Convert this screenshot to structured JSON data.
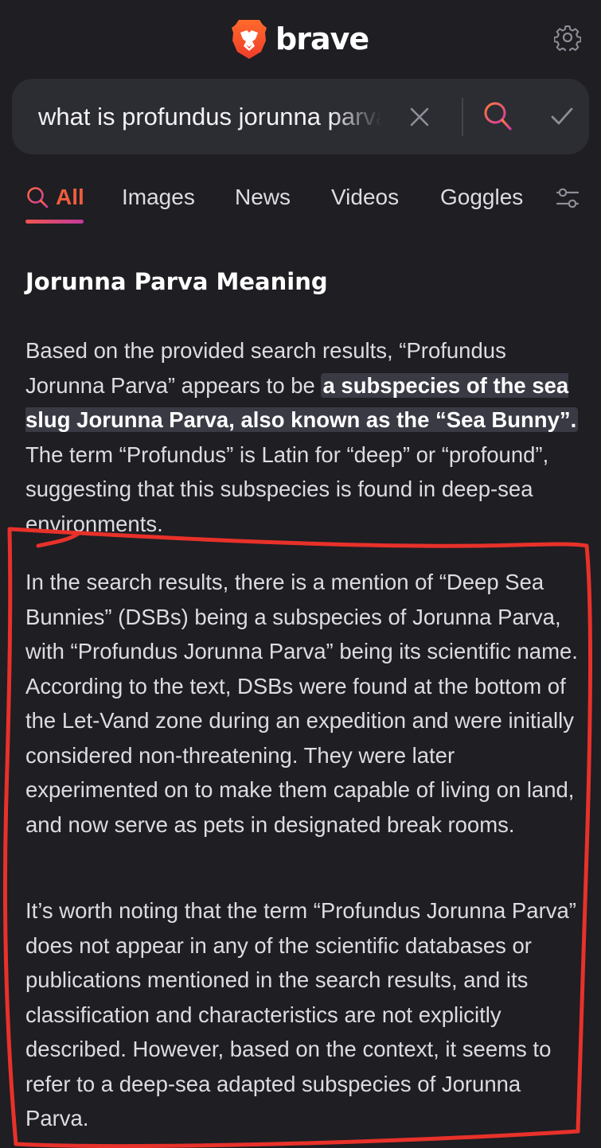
{
  "header": {
    "brand": "brave"
  },
  "search": {
    "query": "what is profundus jorunna parva"
  },
  "tabs": [
    {
      "label": "All",
      "active": true
    },
    {
      "label": "Images"
    },
    {
      "label": "News"
    },
    {
      "label": "Videos"
    },
    {
      "label": "Goggles"
    }
  ],
  "answer": {
    "title": "Jorunna Parva Meaning",
    "p1_before": "Based on the provided search results, “Profundus Jorunna Parva” appears to be ",
    "p1_highlight": "a subspecies of the sea slug Jorunna Parva, also known as the “Sea Bunny”.",
    "p1_after": " The term “Profundus” is Latin for “deep” or “profound”, suggesting that this subspecies is found in deep-sea environments.",
    "p2": "In the search results, there is a mention of “Deep Sea Bunnies” (DSBs) being a subspecies of Jorunna Parva, with “Profundus Jorunna Parva” being its scientific name. According to the text, DSBs were found at the bottom of the Let-Vand zone during an expedition and were initially considered non-threatening. They were later experimented on to make them capable of living on land, and now serve as pets in designated break rooms.",
    "p3": "It’s worth noting that the term “Profundus Jorunna Parva” does not appear in any of the scientific databases or publications mentioned in the search results, and its classification and characteristics are not explicitly described. However, based on the context, it seems to refer to a deep-sea adapted subspecies of Jorunna Parva."
  },
  "colors": {
    "background": "#1e1e23",
    "accent": "#ef5d3c",
    "annotation": "#e8312a"
  },
  "icons": [
    "brave-lion-logo-icon",
    "gear-icon",
    "close-icon",
    "search-icon",
    "check-icon",
    "filter-sliders-icon"
  ]
}
